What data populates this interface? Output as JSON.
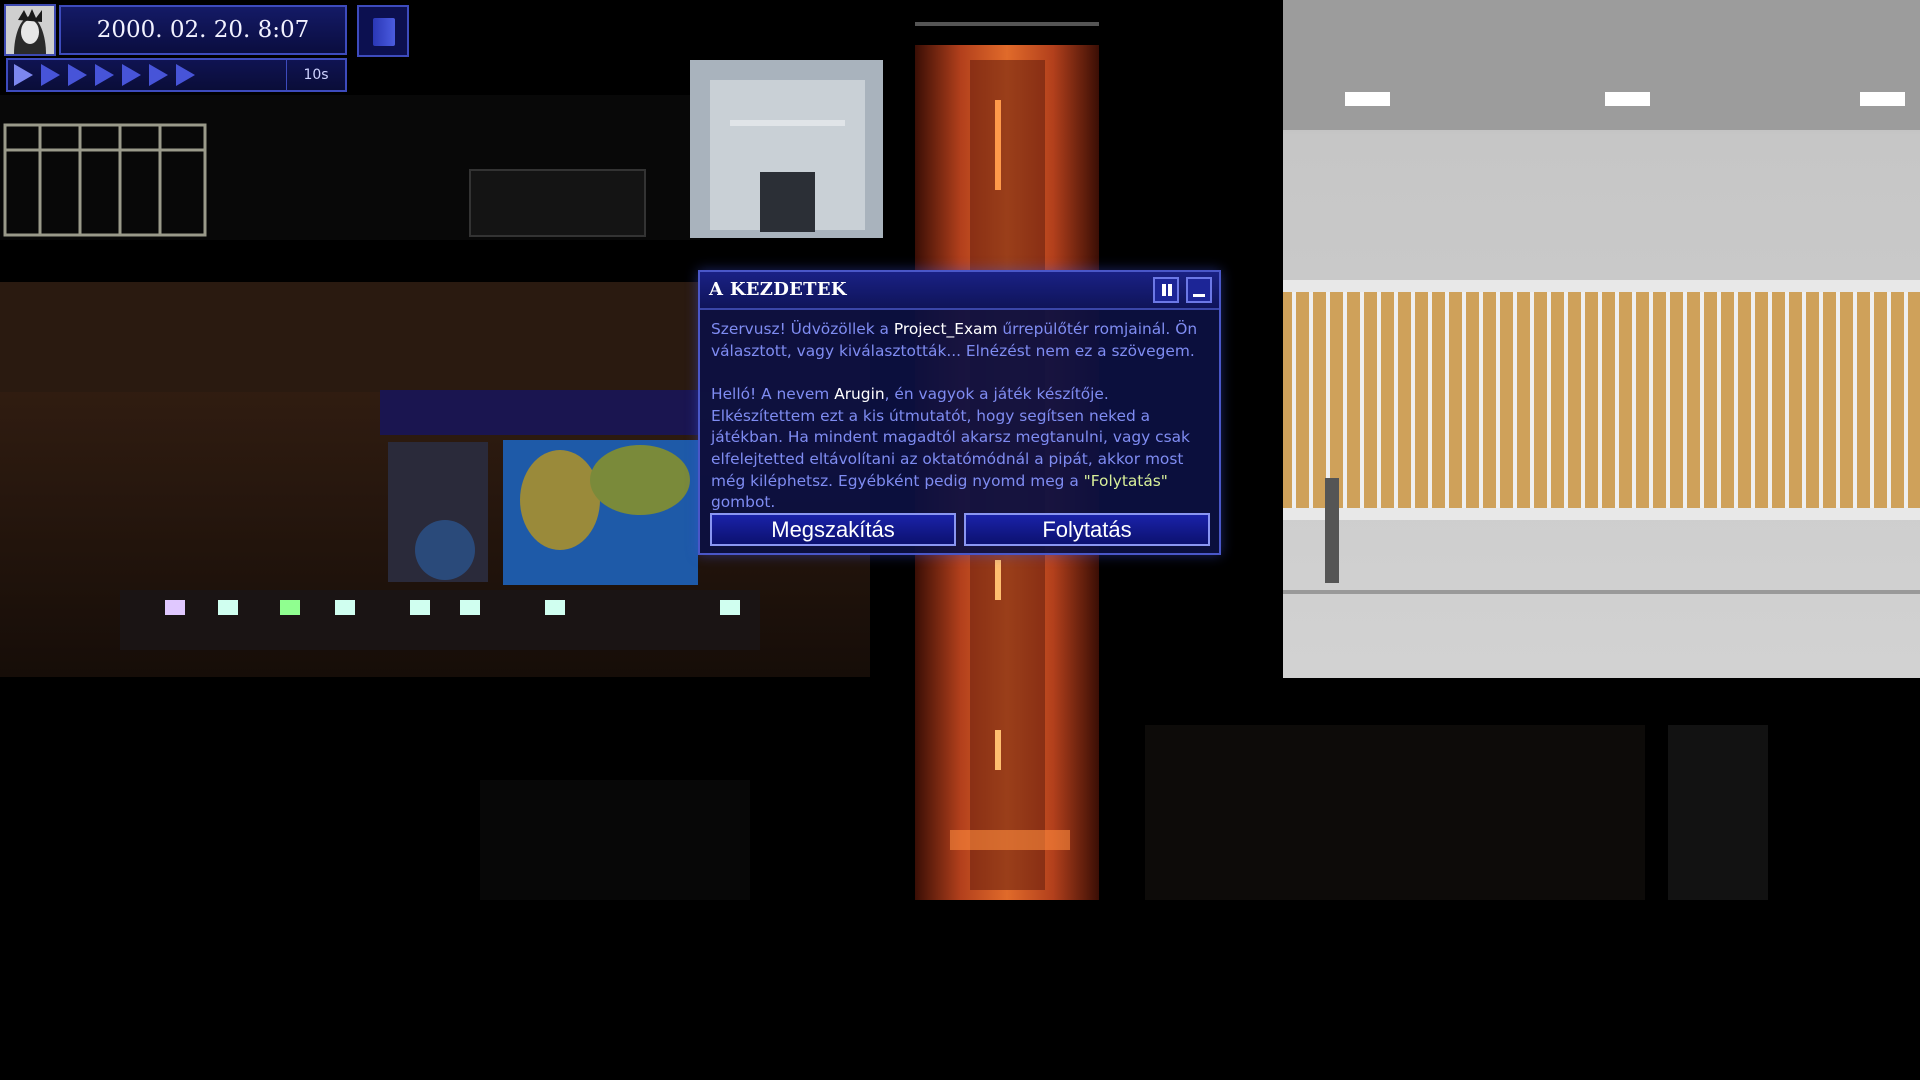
{
  "hud": {
    "datetime": "2000. 02. 20. 8:07",
    "speed_value": "10s",
    "speed_steps": 7
  },
  "dialog": {
    "title": "A KEZDETEK",
    "paragraph1": {
      "t1": "Szervusz! Üdvözöllek a ",
      "project": "Project_Exam",
      "t2": " űrrepülőtér romjainál. Ön választott, vagy kiválasztották... Elnézést nem ez a szövegem."
    },
    "paragraph2": {
      "t1": "Helló! A nevem ",
      "author": "Arugin",
      "t2": ", én vagyok a játék készítője. Elkészítettem ezt a kis útmutatót, hogy segítsen neked a játékban. Ha mindent magadtól akarsz megtanulni, vagy csak elfelejtetted eltávolítani az oktatómódnál a pipát, akkor most még kiléphetsz. Egyébként pedig nyomd meg a ",
      "quote": "\"Folytatás\"",
      "t3": " gombot."
    },
    "cancel_label": "Megszakítás",
    "continue_label": "Folytatás"
  },
  "colors": {
    "accent": "#3d4bbd",
    "dialog_bg": "#0c1042",
    "text": "#7f8cf2",
    "highlight_quote": "#d8f09a"
  }
}
